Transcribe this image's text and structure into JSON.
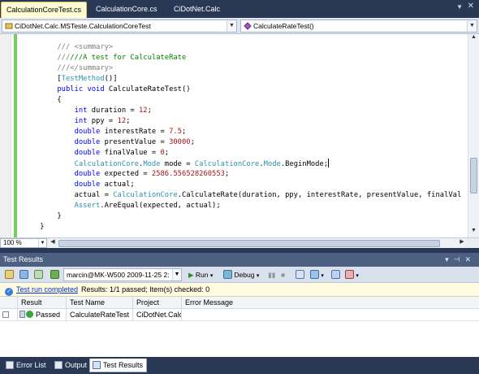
{
  "tabs": [
    {
      "label": "CalculationCoreTest.cs",
      "active": true
    },
    {
      "label": "CalculationCore.cs",
      "active": false
    },
    {
      "label": "CiDotNet.Calc",
      "active": false
    }
  ],
  "navbar": {
    "class_combo": "CiDotNet.Calc.MSTeste.CalculationCoreTest",
    "member_combo": "CalculateRateTest()"
  },
  "code": {
    "l1": "/// <summary>",
    "l2": "///A test for CalculateRate",
    "l3": "///</summary>",
    "l4_attr": "TestMethod",
    "l5_kw": "public void",
    "l5_name": " CalculateRateTest()",
    "brace_open": "{",
    "l7_kw": "int",
    "l7_rest": " duration = ",
    "l7_val": "12",
    "l8_kw": "int",
    "l8_rest": " ppy = ",
    "l8_val": "12",
    "l9_kw": "double",
    "l9_rest": " interestRate = ",
    "l9_val": "7.5",
    "l10_kw": "double",
    "l10_rest": " presentValue = ",
    "l10_val": "30000",
    "l11_kw": "double",
    "l11_rest": " finalValue = ",
    "l11_val": "0",
    "l12_ty1": "CalculationCore",
    "l12_ty2": "Mode",
    "l12_mid": " mode = ",
    "l12_ty3": "CalculationCore",
    "l12_ty4": "Mode",
    "l12_end": "BeginMode;",
    "l13_kw": "double",
    "l13_rest": " expected = ",
    "l13_val": "2586.556528260553",
    "l14_kw": "double",
    "l14_rest": " actual;",
    "l15_start": "actual = ",
    "l15_ty": "CalculationCore",
    "l15_rest": ".CalculateRate(duration, ppy, interestRate, presentValue, finalVal",
    "l16_ty": "Assert",
    "l16_rest": ".AreEqual(expected, actual);",
    "brace_close_inner": "}",
    "brace_close_outer": "}"
  },
  "editor": {
    "zoom": "100 %"
  },
  "test_results": {
    "title": "Test Results",
    "run_combo": "marcin@MK-W500 2009-11-25 2:",
    "run_button": "Run",
    "debug_button": "Debug",
    "status_link": "Test run completed",
    "status_text": "Results: 1/1 passed;  Item(s) checked: 0",
    "columns": [
      "Result",
      "Test Name",
      "Project",
      "Error Message"
    ],
    "rows": [
      {
        "result": "Passed",
        "test_name": "CalculateRateTest",
        "project": "CiDotNet.Calc.",
        "error": ""
      }
    ]
  },
  "bottom_tabs": [
    {
      "label": "Error List",
      "active": false
    },
    {
      "label": "Output",
      "active": false
    },
    {
      "label": "Test Results",
      "active": true
    }
  ],
  "colors": {
    "keyword": "#0000ff",
    "type": "#2b91af",
    "string_literal": "#a31515",
    "comment": "#008000",
    "chrome": "#293955"
  }
}
